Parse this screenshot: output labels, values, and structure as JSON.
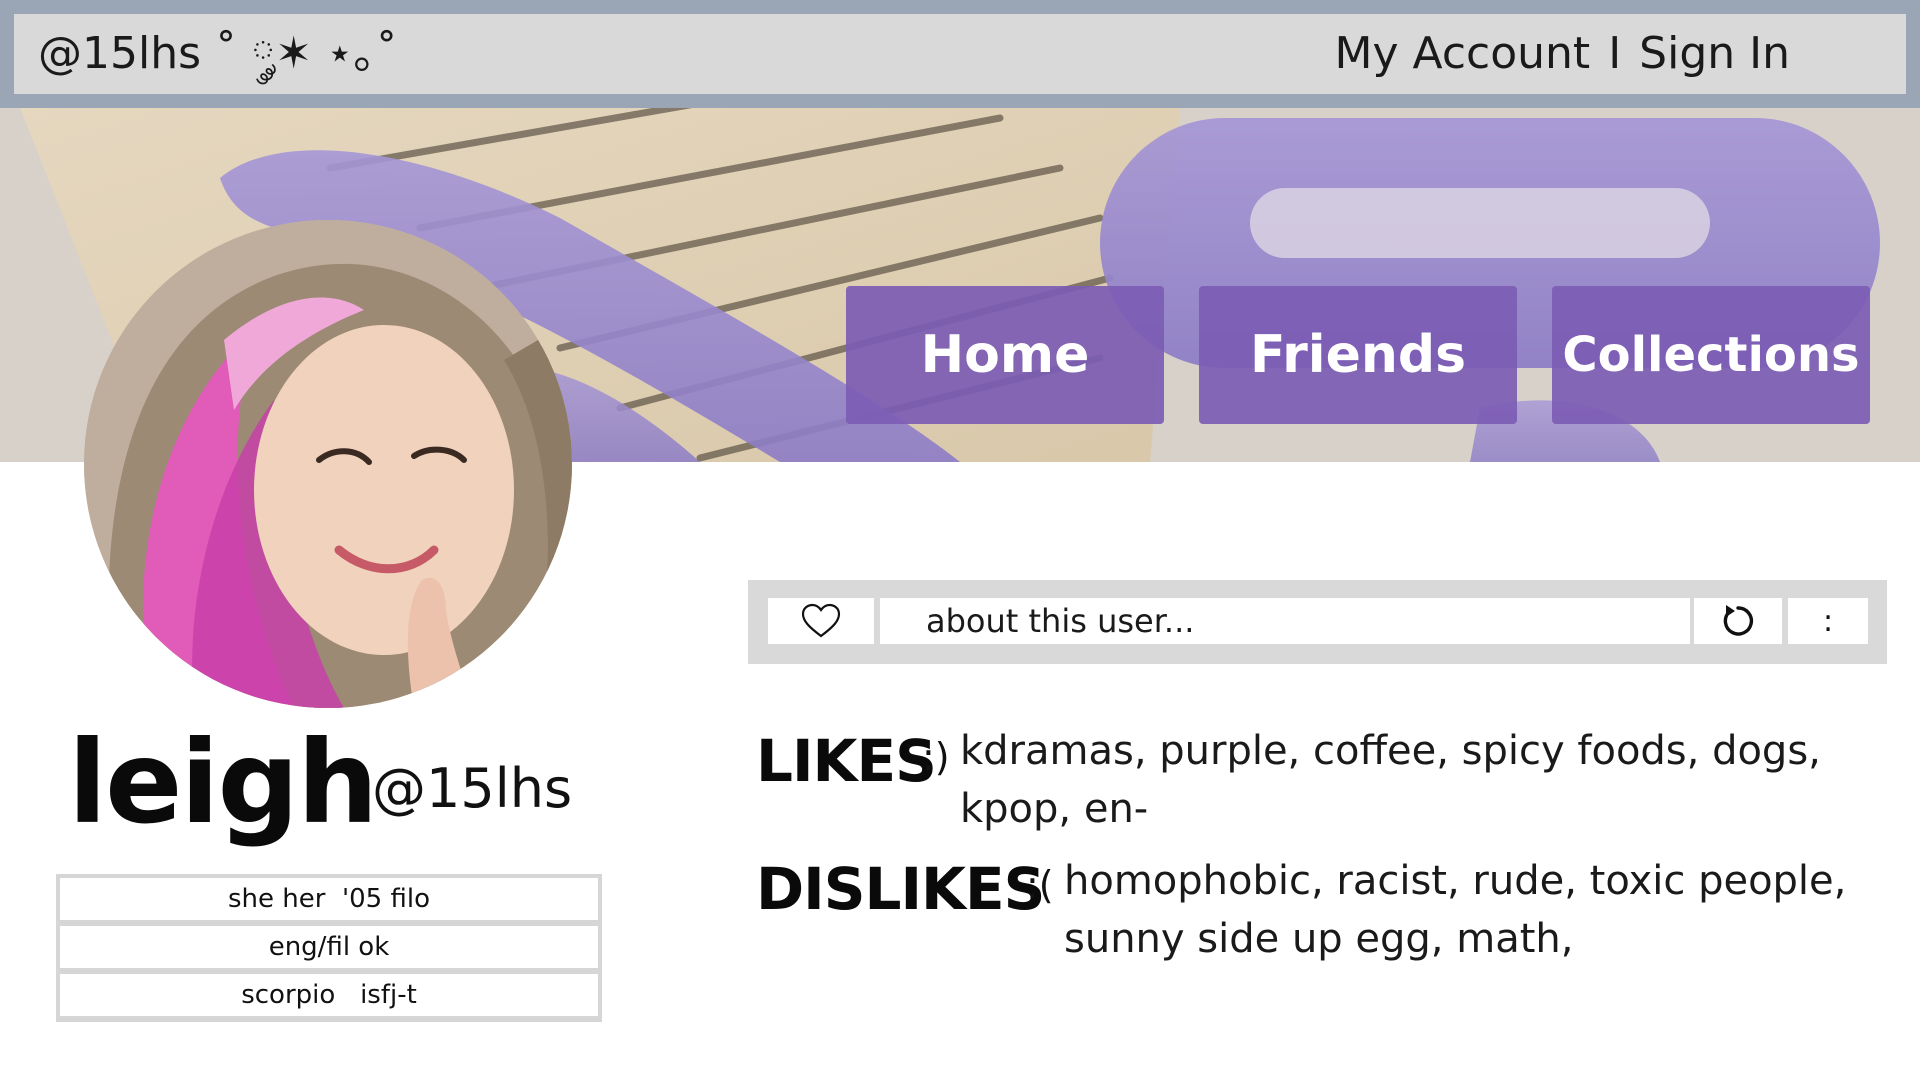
{
  "header": {
    "site_handle": "@15lhs ˚ ༘✶ ⋆｡˚",
    "my_account": "My Account",
    "separator": "I",
    "sign_in": "Sign In"
  },
  "nav": {
    "home": "Home",
    "friends": "Friends",
    "collections": "Collections"
  },
  "profile": {
    "display_name": "leigh",
    "handle": "@15lhs",
    "info": [
      "she her  '05 filo",
      "eng/fil ok",
      "scorpio   isfj-t"
    ]
  },
  "about": {
    "placeholder_text": "about this user...",
    "more_label": ":",
    "icons": [
      "heart-icon",
      "refresh-icon"
    ]
  },
  "likes": {
    "label": "LIKES",
    "emote": ":)",
    "text": "kdramas, purple, coffee, spicy foods, dogs, kpop, en-"
  },
  "dislikes": {
    "label": "DISLIKES",
    "emote": ":(",
    "text": "homophobic, racist, rude, toxic people, sunny side up egg, math,"
  },
  "colors": {
    "topbar_frame": "#9aa6b5",
    "topbar": "#d9d9d9",
    "nav_button": "#7c5cb4",
    "about_bar": "#d9d9d9"
  }
}
